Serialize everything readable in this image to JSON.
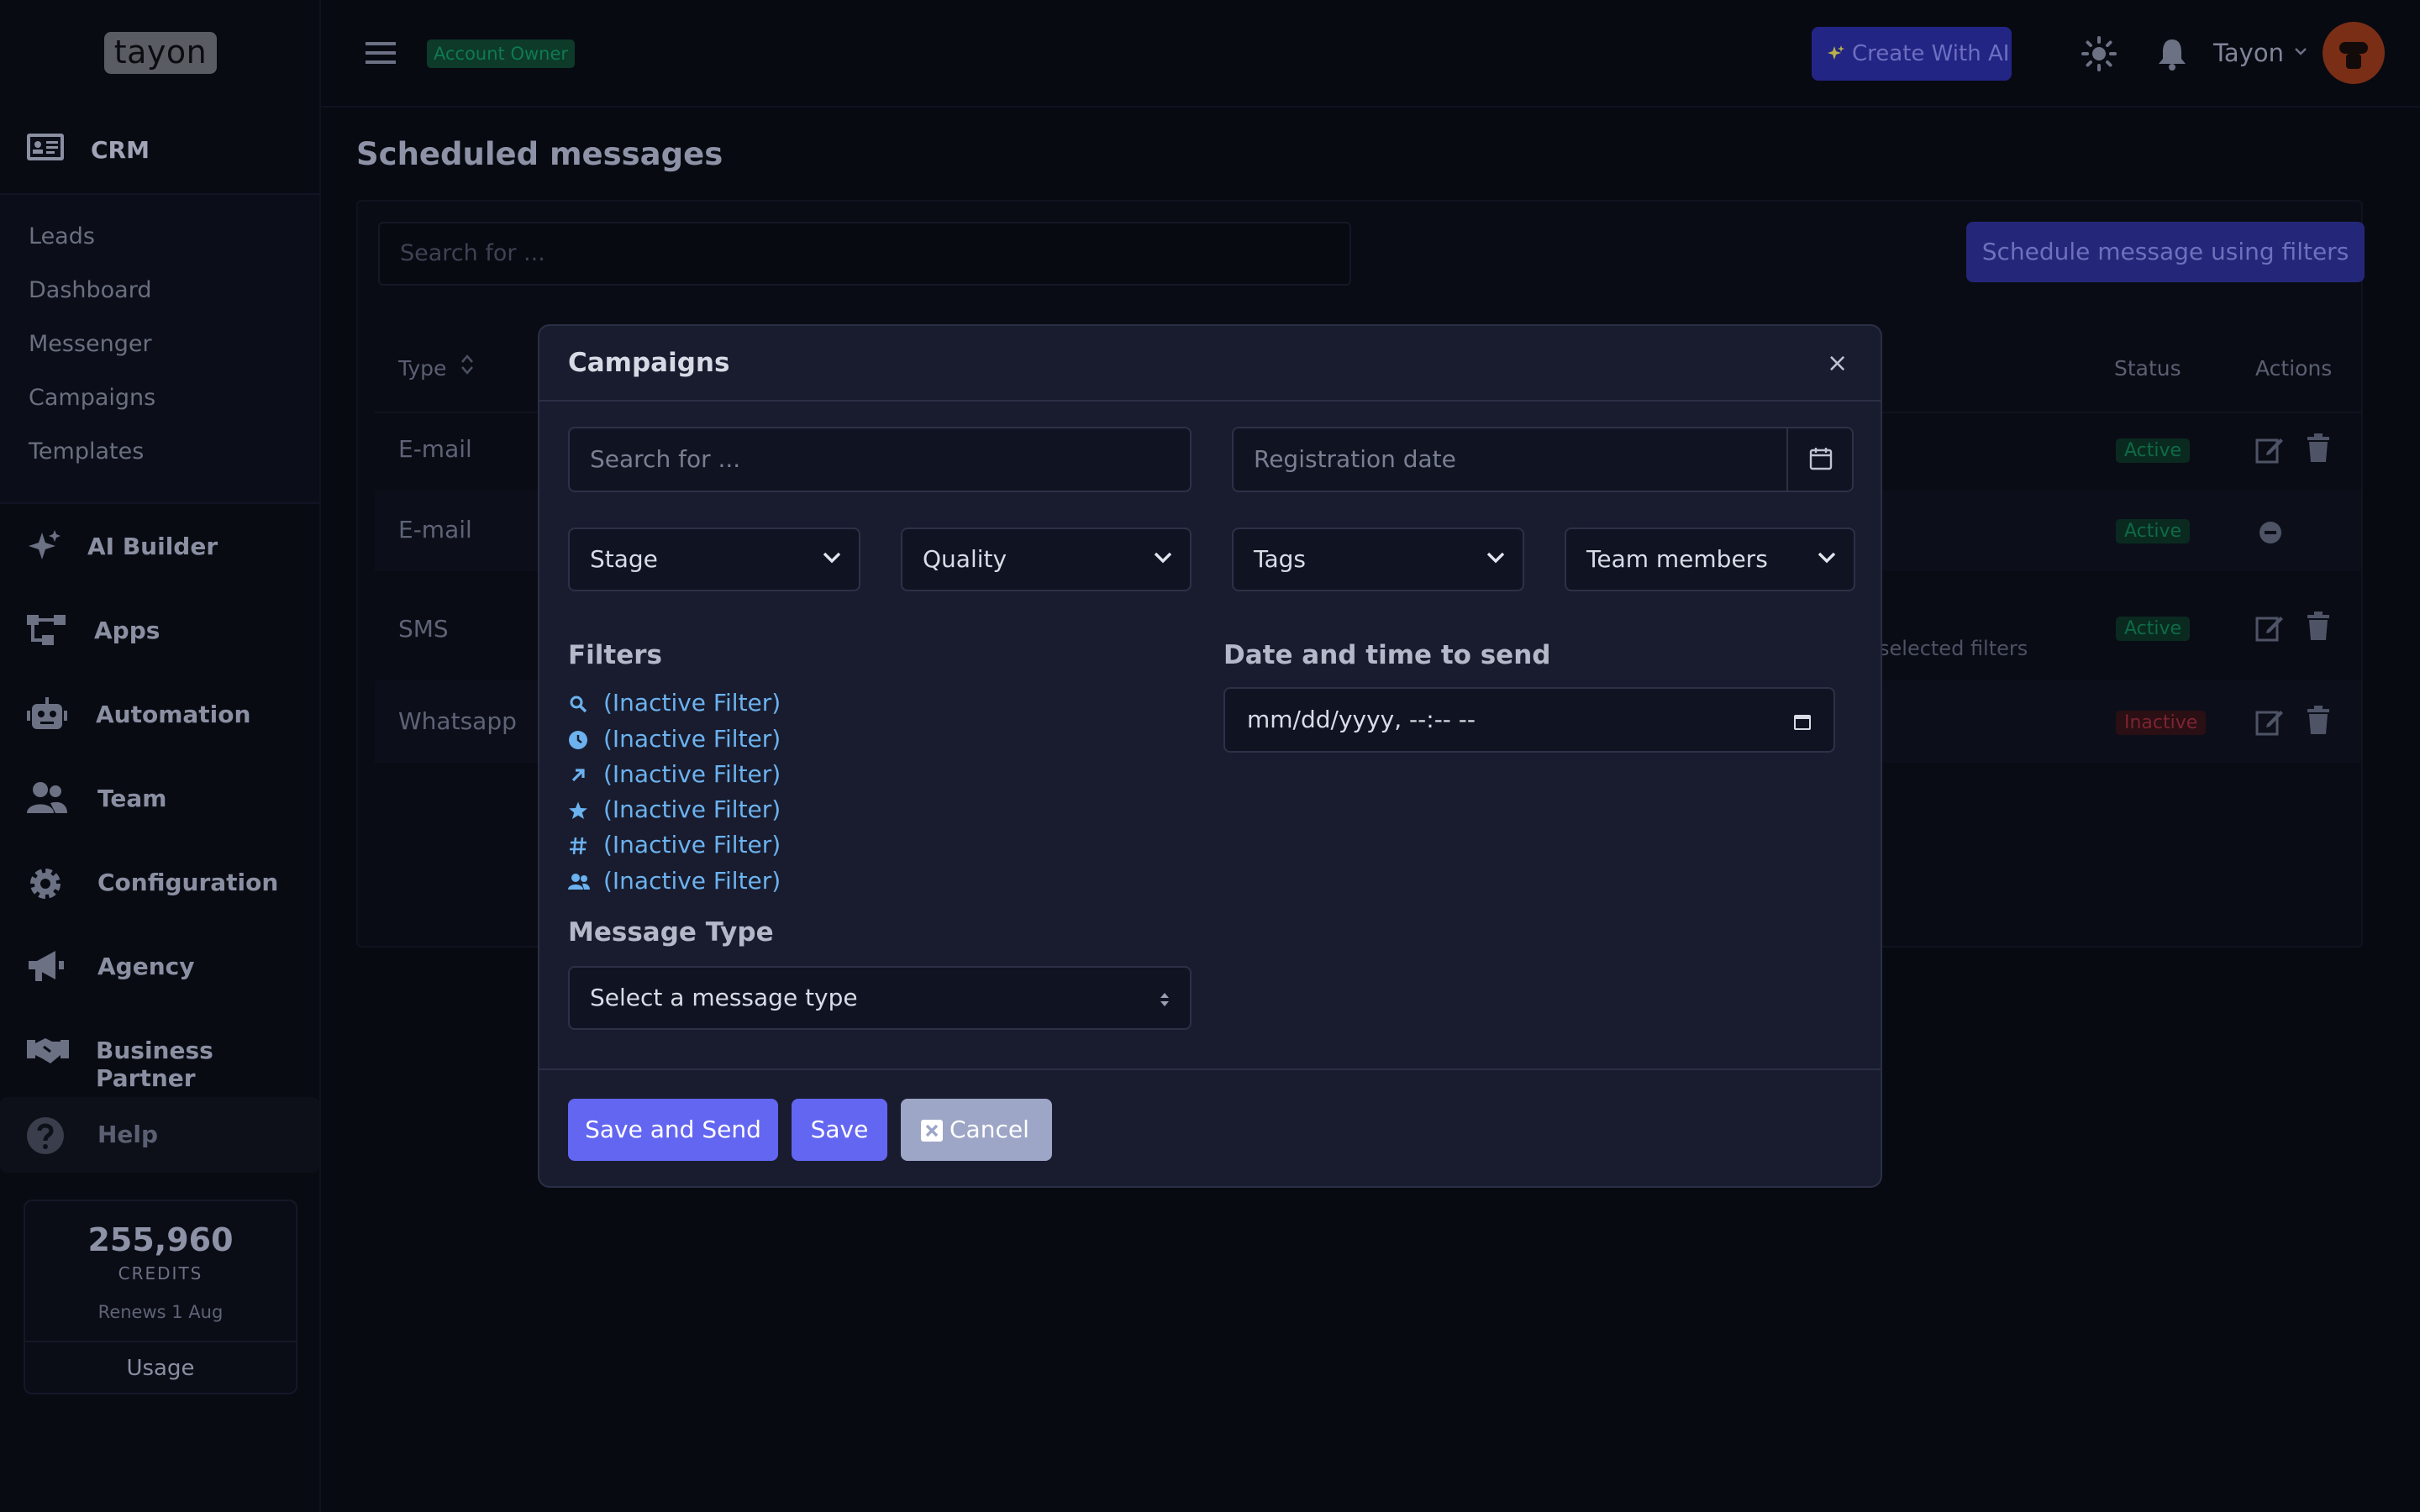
{
  "app": {
    "logo": "tayon",
    "account_badge": "Account Owner"
  },
  "sidebar": {
    "crm_label": "CRM",
    "sub_items": [
      "Leads",
      "Dashboard",
      "Messenger",
      "Campaigns",
      "Templates"
    ],
    "items": [
      {
        "label": "AI Builder",
        "icon": "sparkles-icon"
      },
      {
        "label": "Apps",
        "icon": "apps-icon"
      },
      {
        "label": "Automation",
        "icon": "robot-icon"
      },
      {
        "label": "Team",
        "icon": "team-icon"
      },
      {
        "label": "Configuration",
        "icon": "gear-icon"
      },
      {
        "label": "Agency",
        "icon": "megaphone-icon"
      },
      {
        "label": "Business Partner",
        "icon": "handshake-icon"
      },
      {
        "label": "Help",
        "icon": "help-icon"
      }
    ],
    "credits": {
      "amount": "255,960",
      "label": "CREDITS",
      "renews": "Renews 1 Aug",
      "usage_label": "Usage"
    }
  },
  "topbar": {
    "create_ai_label": "Create With AI",
    "user_name": "Tayon"
  },
  "page": {
    "title": "Scheduled messages",
    "search_placeholder": "Search for ...",
    "schedule_button": "Schedule message using filters",
    "columns": {
      "type": "Type",
      "status": "Status",
      "actions": "Actions"
    },
    "rows": [
      {
        "type": "E-mail",
        "status": "Active"
      },
      {
        "type": "E-mail",
        "status": "Active"
      },
      {
        "type": "SMS",
        "status": "Active",
        "note": "selected filters"
      },
      {
        "type": "Whatsapp",
        "status": "Inactive"
      }
    ]
  },
  "modal": {
    "title": "Campaigns",
    "close_symbol": "×",
    "search_placeholder": "Search for ...",
    "registration_placeholder": "Registration date",
    "selects": [
      "Stage",
      "Quality",
      "Tags",
      "Team members"
    ],
    "filters_label": "Filters",
    "filters": [
      {
        "icon": "search-icon",
        "text": "(Inactive Filter)"
      },
      {
        "icon": "clock-icon",
        "text": "(Inactive Filter)"
      },
      {
        "icon": "arrow-up-right-icon",
        "text": "(Inactive Filter)"
      },
      {
        "icon": "star-icon",
        "text": "(Inactive Filter)"
      },
      {
        "icon": "hash-icon",
        "text": "(Inactive Filter)"
      },
      {
        "icon": "users-icon",
        "text": "(Inactive Filter)"
      }
    ],
    "date_label": "Date and time to send",
    "datetime_placeholder": "mm/dd/yyyy, --:-- --",
    "message_type_label": "Message Type",
    "message_type_placeholder": "Select a message type",
    "buttons": {
      "save_send": "Save and Send",
      "save": "Save",
      "cancel": "Cancel"
    }
  },
  "colors": {
    "primary": "#6366f1",
    "secondary": "#9da6c6",
    "filter_link": "#6cb2ef",
    "modal_bg": "#181c2e",
    "page_bg": "#080a12"
  }
}
